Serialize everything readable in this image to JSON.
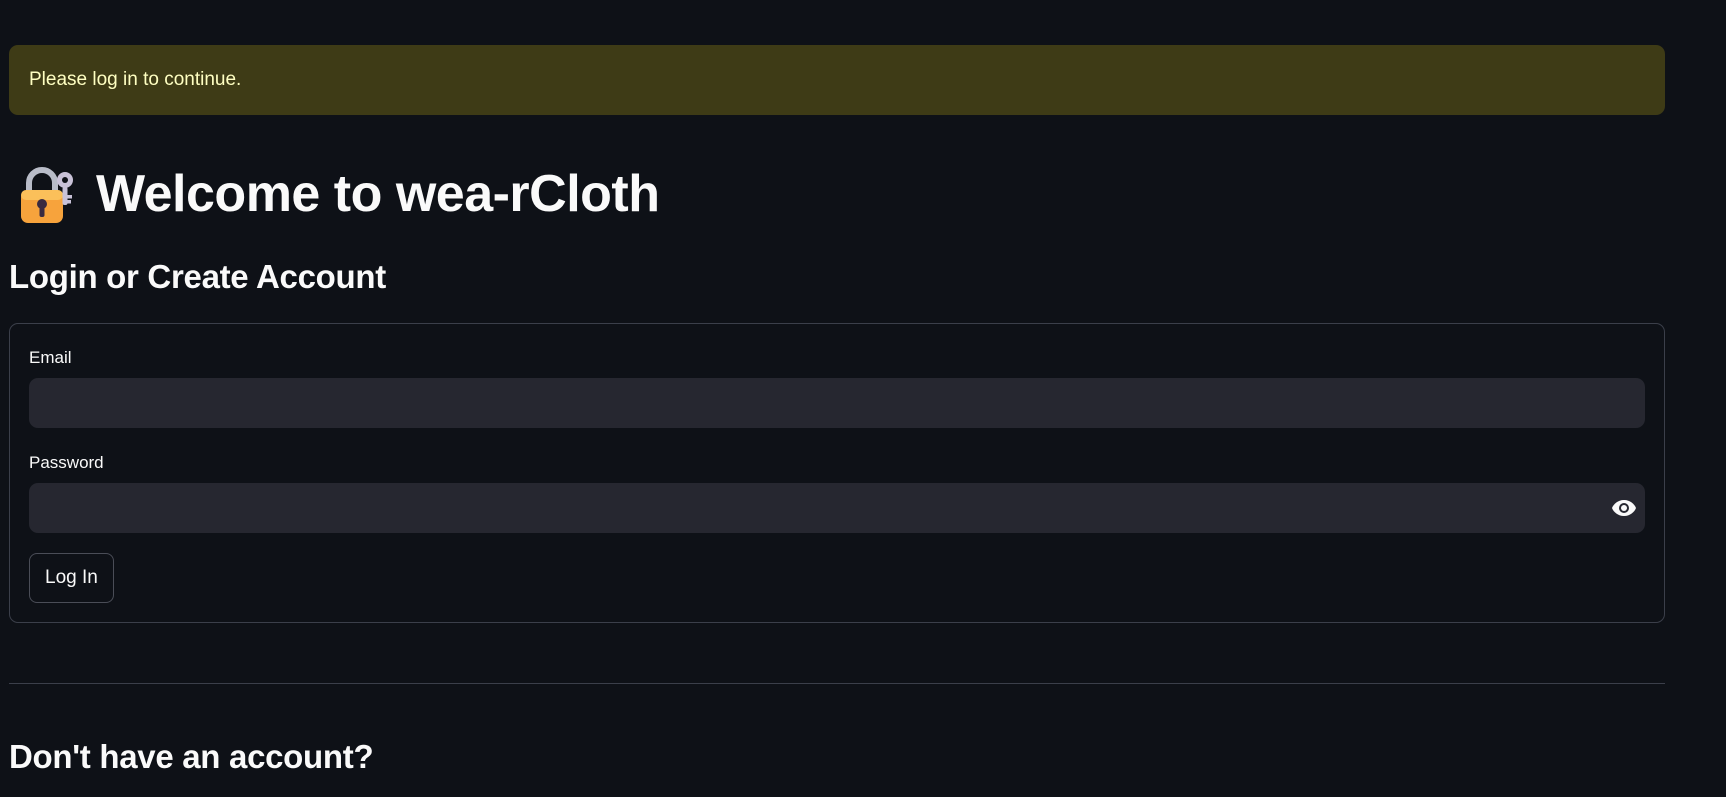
{
  "alert": {
    "message": "Please log in to continue."
  },
  "header": {
    "emoji_icon": "lock-with-key-icon",
    "title": "Welcome to wea-rCloth",
    "subtitle": "Login or Create Account"
  },
  "login_form": {
    "email_label": "Email",
    "email_value": "",
    "password_label": "Password",
    "password_value": "",
    "show_password_icon": "eye-icon",
    "submit_label": "Log In"
  },
  "signup": {
    "heading": "Don't have an account?"
  },
  "colors": {
    "background": "#0e1117",
    "warning_bg": "#3e3b16",
    "warning_text": "#ffffc2",
    "input_bg": "#262730",
    "border": "#3b3f4a"
  }
}
